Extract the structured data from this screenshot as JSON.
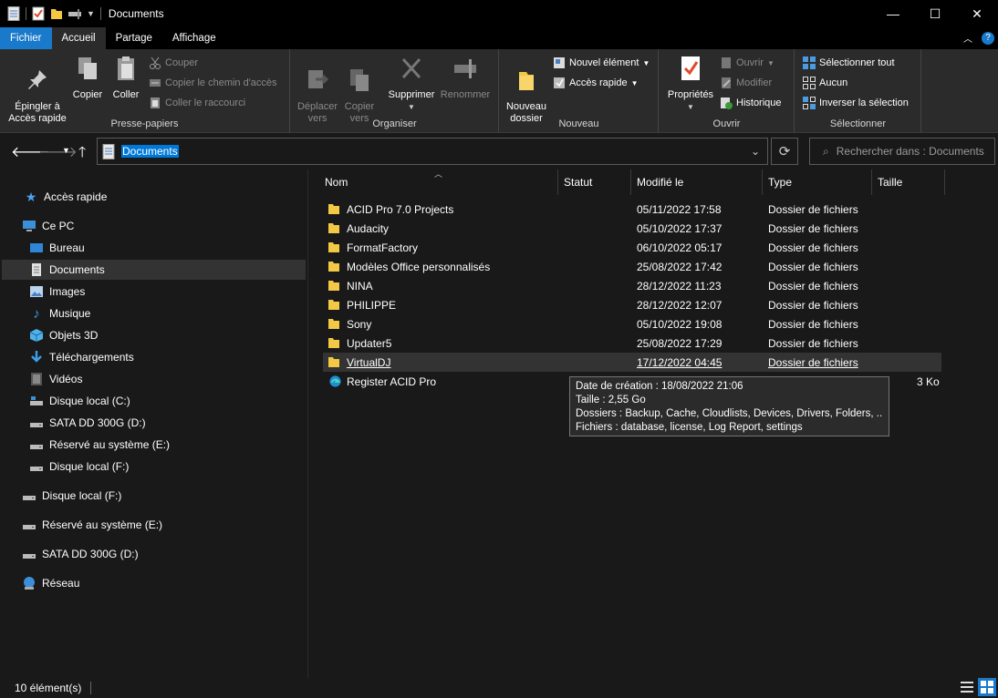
{
  "window": {
    "title": "Documents"
  },
  "tabs": [
    "Fichier",
    "Accueil",
    "Partage",
    "Affichage"
  ],
  "ribbon": {
    "clipboard": {
      "label": "Presse-papiers",
      "pin": "Épingler à\nAccès rapide",
      "copy": "Copier",
      "paste": "Coller",
      "cut": "Couper",
      "copy_path": "Copier le chemin d'accès",
      "paste_shortcut": "Coller le raccourci"
    },
    "organize": {
      "label": "Organiser",
      "move": "Déplacer\nvers",
      "copy_to": "Copier\nvers",
      "delete": "Supprimer",
      "rename": "Renommer"
    },
    "new": {
      "label": "Nouveau",
      "new_folder": "Nouveau\ndossier",
      "new_item": "Nouvel élément",
      "quick_access": "Accès rapide"
    },
    "open": {
      "label": "Ouvrir",
      "properties": "Propriétés",
      "open": "Ouvrir",
      "edit": "Modifier",
      "history": "Historique"
    },
    "select": {
      "label": "Sélectionner",
      "all": "Sélectionner tout",
      "none": "Aucun",
      "invert": "Inverser la sélection"
    }
  },
  "address": {
    "path": "Documents",
    "search_placeholder": "Rechercher dans : Documents"
  },
  "nav": [
    {
      "label": "Accès rapide",
      "icon": "star-icon"
    },
    {
      "label": "Ce PC",
      "icon": "pc-icon"
    },
    {
      "label": "Bureau",
      "icon": "desktop-icon"
    },
    {
      "label": "Documents",
      "icon": "document-icon"
    },
    {
      "label": "Images",
      "icon": "images-icon"
    },
    {
      "label": "Musique",
      "icon": "music-icon"
    },
    {
      "label": "Objets 3D",
      "icon": "cube-icon"
    },
    {
      "label": "Téléchargements",
      "icon": "download-icon"
    },
    {
      "label": "Vidéos",
      "icon": "video-icon"
    },
    {
      "label": "Disque local (C:)",
      "icon": "drive-icon"
    },
    {
      "label": "SATA DD 300G (D:)",
      "icon": "drive-icon"
    },
    {
      "label": "Réservé au système (E:)",
      "icon": "drive-icon"
    },
    {
      "label": "Disque local (F:)",
      "icon": "drive-icon"
    },
    {
      "label": "Disque local (F:)",
      "icon": "drive-icon"
    },
    {
      "label": "Réservé au système (E:)",
      "icon": "drive-icon"
    },
    {
      "label": "SATA DD 300G (D:)",
      "icon": "drive-icon"
    },
    {
      "label": "Réseau",
      "icon": "network-icon"
    }
  ],
  "columns": {
    "name": "Nom",
    "status": "Statut",
    "modified": "Modifié le",
    "type": "Type",
    "size": "Taille"
  },
  "files": [
    {
      "name": "ACID Pro 7.0 Projects",
      "modified": "05/11/2022 17:58",
      "type": "Dossier de fichiers",
      "size": ""
    },
    {
      "name": "Audacity",
      "modified": "05/10/2022 17:37",
      "type": "Dossier de fichiers",
      "size": ""
    },
    {
      "name": "FormatFactory",
      "modified": "06/10/2022 05:17",
      "type": "Dossier de fichiers",
      "size": ""
    },
    {
      "name": "Modèles Office personnalisés",
      "modified": "25/08/2022 17:42",
      "type": "Dossier de fichiers",
      "size": ""
    },
    {
      "name": "NINA",
      "modified": "28/12/2022 11:23",
      "type": "Dossier de fichiers",
      "size": ""
    },
    {
      "name": "PHILIPPE",
      "modified": "28/12/2022 12:07",
      "type": "Dossier de fichiers",
      "size": ""
    },
    {
      "name": "Sony",
      "modified": "05/10/2022 19:08",
      "type": "Dossier de fichiers",
      "size": ""
    },
    {
      "name": "Updater5",
      "modified": "25/08/2022 17:29",
      "type": "Dossier de fichiers",
      "size": ""
    },
    {
      "name": "VirtualDJ",
      "modified": "17/12/2022 04:45",
      "type": "Dossier de fichiers",
      "size": ""
    },
    {
      "name": "Register ACID Pro",
      "modified": "",
      "type": "",
      "size": "3 Ko"
    }
  ],
  "tooltip": {
    "created": "Date de création : 18/08/2022 21:06",
    "size": "Taille : 2,55 Go",
    "folders": "Dossiers : Backup, Cache, Cloudlists, Devices, Drivers, Folders, ...",
    "files": "Fichiers : database, license, Log Report, settings"
  },
  "status": {
    "count": "10 élément(s)"
  },
  "colors": {
    "accent": "#1979ca",
    "folder": "#f3c844",
    "selection": "#0078d7"
  }
}
